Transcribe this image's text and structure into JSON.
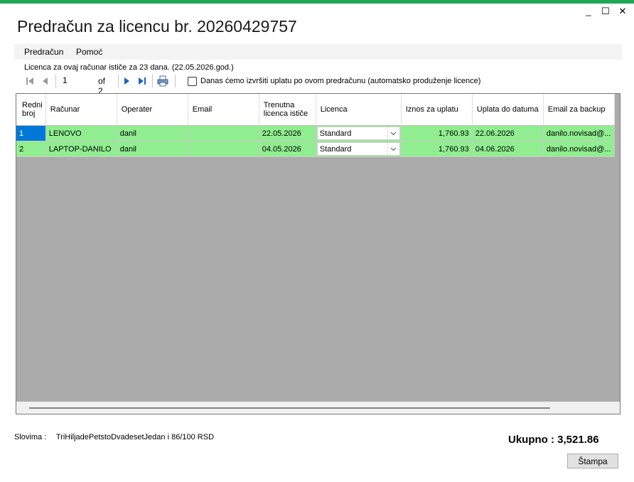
{
  "window": {
    "title": "Predračun za licencu br. 20260429757",
    "controls": {
      "minimize": "_",
      "maximize": "☐",
      "close": "✕"
    },
    "accent_color": "#1fa855"
  },
  "menu": {
    "items": [
      {
        "label": "Predračun"
      },
      {
        "label": "Pomoć"
      }
    ]
  },
  "info_text": "Licenca za ovaj računar ističe za 23 dana. (22.05.2026.god.)",
  "toolbar": {
    "position_value": "1",
    "of_label": "of 2",
    "checkbox_label": "Danas ćemo izvršiti uplatu po ovom predračunu (automatsko produženje licence)",
    "checkbox_checked": false,
    "icons": [
      "move-first-icon",
      "move-previous-icon",
      "move-next-icon",
      "move-last-icon",
      "printer-icon"
    ]
  },
  "grid": {
    "columns": [
      {
        "label": "Redni broj"
      },
      {
        "label": "Računar"
      },
      {
        "label": "Operater"
      },
      {
        "label": "Email"
      },
      {
        "label": "Trenutna licenca ističe"
      },
      {
        "label": "Licenca"
      },
      {
        "label": "Iznos za uplatu"
      },
      {
        "label": "Uplata do datuma"
      },
      {
        "label": "Email za backup"
      }
    ],
    "rows": [
      {
        "no": "1",
        "computer": "LENOVO",
        "operator": "danil",
        "email": "",
        "expires": "22.05.2026",
        "license": "Standard",
        "amount": "1,760.93",
        "pay_by": "22.06.2026",
        "backup_email": "danilo.novisad@..."
      },
      {
        "no": "2",
        "computer": "LAPTOP-DANILO",
        "operator": "danil",
        "email": "",
        "expires": "04.05.2026",
        "license": "Standard",
        "amount": "1,760.93",
        "pay_by": "04.06.2026",
        "backup_email": "danilo.novisad@..."
      }
    ],
    "row_color": "#90ee90",
    "selected_color": "#0078d7",
    "empty_color": "#ababab"
  },
  "footer": {
    "words_label": "Slovima :",
    "words_value": "TriHiljadePetstoDvadesetJedan i 86/100 RSD",
    "total": "Ukupno : 3,521.86",
    "print_button": "Štampa"
  }
}
